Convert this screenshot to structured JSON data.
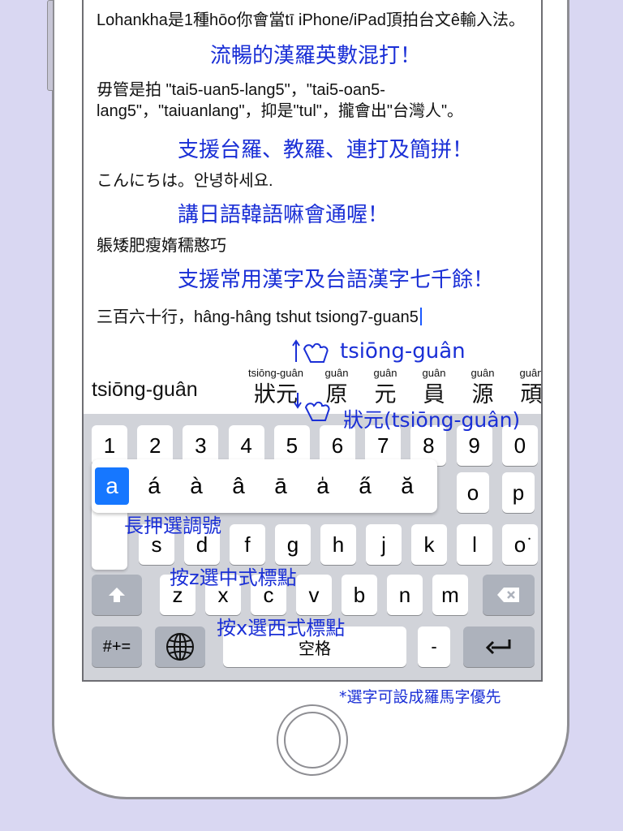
{
  "content": {
    "p1": "Lohankha是1種hōo你會當tī iPhone/iPad頂拍台文ê輸入法。",
    "cap1": "流暢的漢羅英數混打！",
    "p2": "毋管是拍 \"tai5-uan5-lang5\"，\"tai5-oan5-lang5\"，\"taiuanlang\"，抑是\"tul\"，攏會出\"台灣人\"。",
    "cap2": "支援台羅、教羅、連打及簡拼！",
    "p3": "こんにちは。안녕하세요.",
    "cap3": "講日語韓語嘛會通喔！",
    "p4": "躼矮肥瘦媠穤憨巧",
    "cap4": "支援常用漢字及台語漢字七千餘！",
    "p5": "三百六十行，hâng-hâng tshut tsiong7-guan5"
  },
  "annotations": {
    "swipe_up": "tsiōng-guân",
    "tap_candidate": "狀元(tsiōng-guân)",
    "long_press": "長押選調號",
    "z_key": "按z選中式標點",
    "x_key": "按x選西式標點",
    "footnote": "*選字可設成羅馬字優先"
  },
  "candidates": {
    "main": "tsiōng-guân",
    "items": [
      {
        "rom": "tsiōng-guân",
        "han": "狀元"
      },
      {
        "rom": "guân",
        "han": "原"
      },
      {
        "rom": "guân",
        "han": "元"
      },
      {
        "rom": "guân",
        "han": "員"
      },
      {
        "rom": "guân",
        "han": "源"
      },
      {
        "rom": "guân",
        "han": "頑"
      }
    ]
  },
  "keyboard": {
    "numbers": [
      "1",
      "2",
      "3",
      "4",
      "5",
      "6",
      "7",
      "8",
      "9",
      "0"
    ],
    "popup": [
      "a",
      "á",
      "à",
      "â",
      "ā",
      "a̍",
      "a̋",
      "ă"
    ],
    "row2_right": [
      "o",
      "p"
    ],
    "row3": [
      "s",
      "d",
      "f",
      "g",
      "h",
      "j",
      "k",
      "l",
      "o͘"
    ],
    "row4": [
      "z",
      "x",
      "c",
      "v",
      "b",
      "n",
      "m"
    ],
    "symbols_label": "#+=",
    "space_label": "空格",
    "hyphen_label": "-"
  },
  "icons": {
    "globe": "globe-icon",
    "shift": "shift-icon",
    "backspace": "backspace-icon",
    "return": "return-icon",
    "swipe_up": "swipe-up-hand-icon",
    "tap": "tap-hand-icon"
  },
  "colors": {
    "background": "#d9d7f2",
    "annotation_blue": "#1a2fd6",
    "key_highlight": "#1677ff",
    "keyboard_bg": "#d1d3d9"
  }
}
